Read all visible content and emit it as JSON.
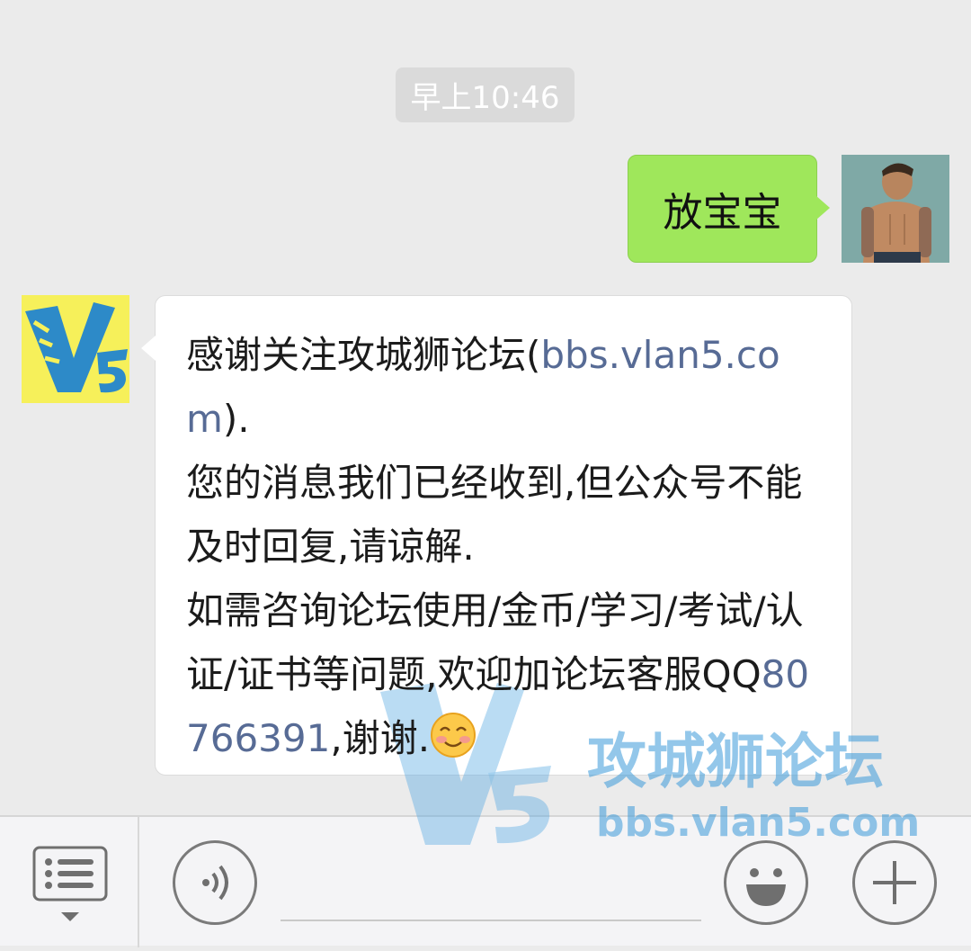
{
  "timestamp": "早上10:46",
  "outgoing": {
    "text": "放宝宝"
  },
  "incoming": {
    "line1": "感谢关注攻城狮论坛(",
    "link": "bbs.vlan5.com",
    "line1_end": ").",
    "line2": "您的消息我们已经收到,但公众号不能及时回复,请谅解.",
    "line3": "如需咨询论坛使用/金币/学习/考试/认证/证书等问题,欢迎加论坛客服",
    "qq_prefix": "QQ",
    "qq": "80766391",
    "line3_end": ",谢谢."
  },
  "watermark": {
    "title": "攻城狮论坛",
    "url": "bbs.vlan5.com",
    "logo": "V5"
  },
  "icons": {
    "menu": "menu-list-icon",
    "voice": "voice-icon",
    "emoji": "emoji-icon",
    "plus": "plus-icon",
    "smiley": "blush-smiley-emoji"
  },
  "colors": {
    "outgoing_bubble": "#9fe75b",
    "incoming_bubble": "#ffffff",
    "link": "#576b95",
    "background": "#ebebeb"
  }
}
